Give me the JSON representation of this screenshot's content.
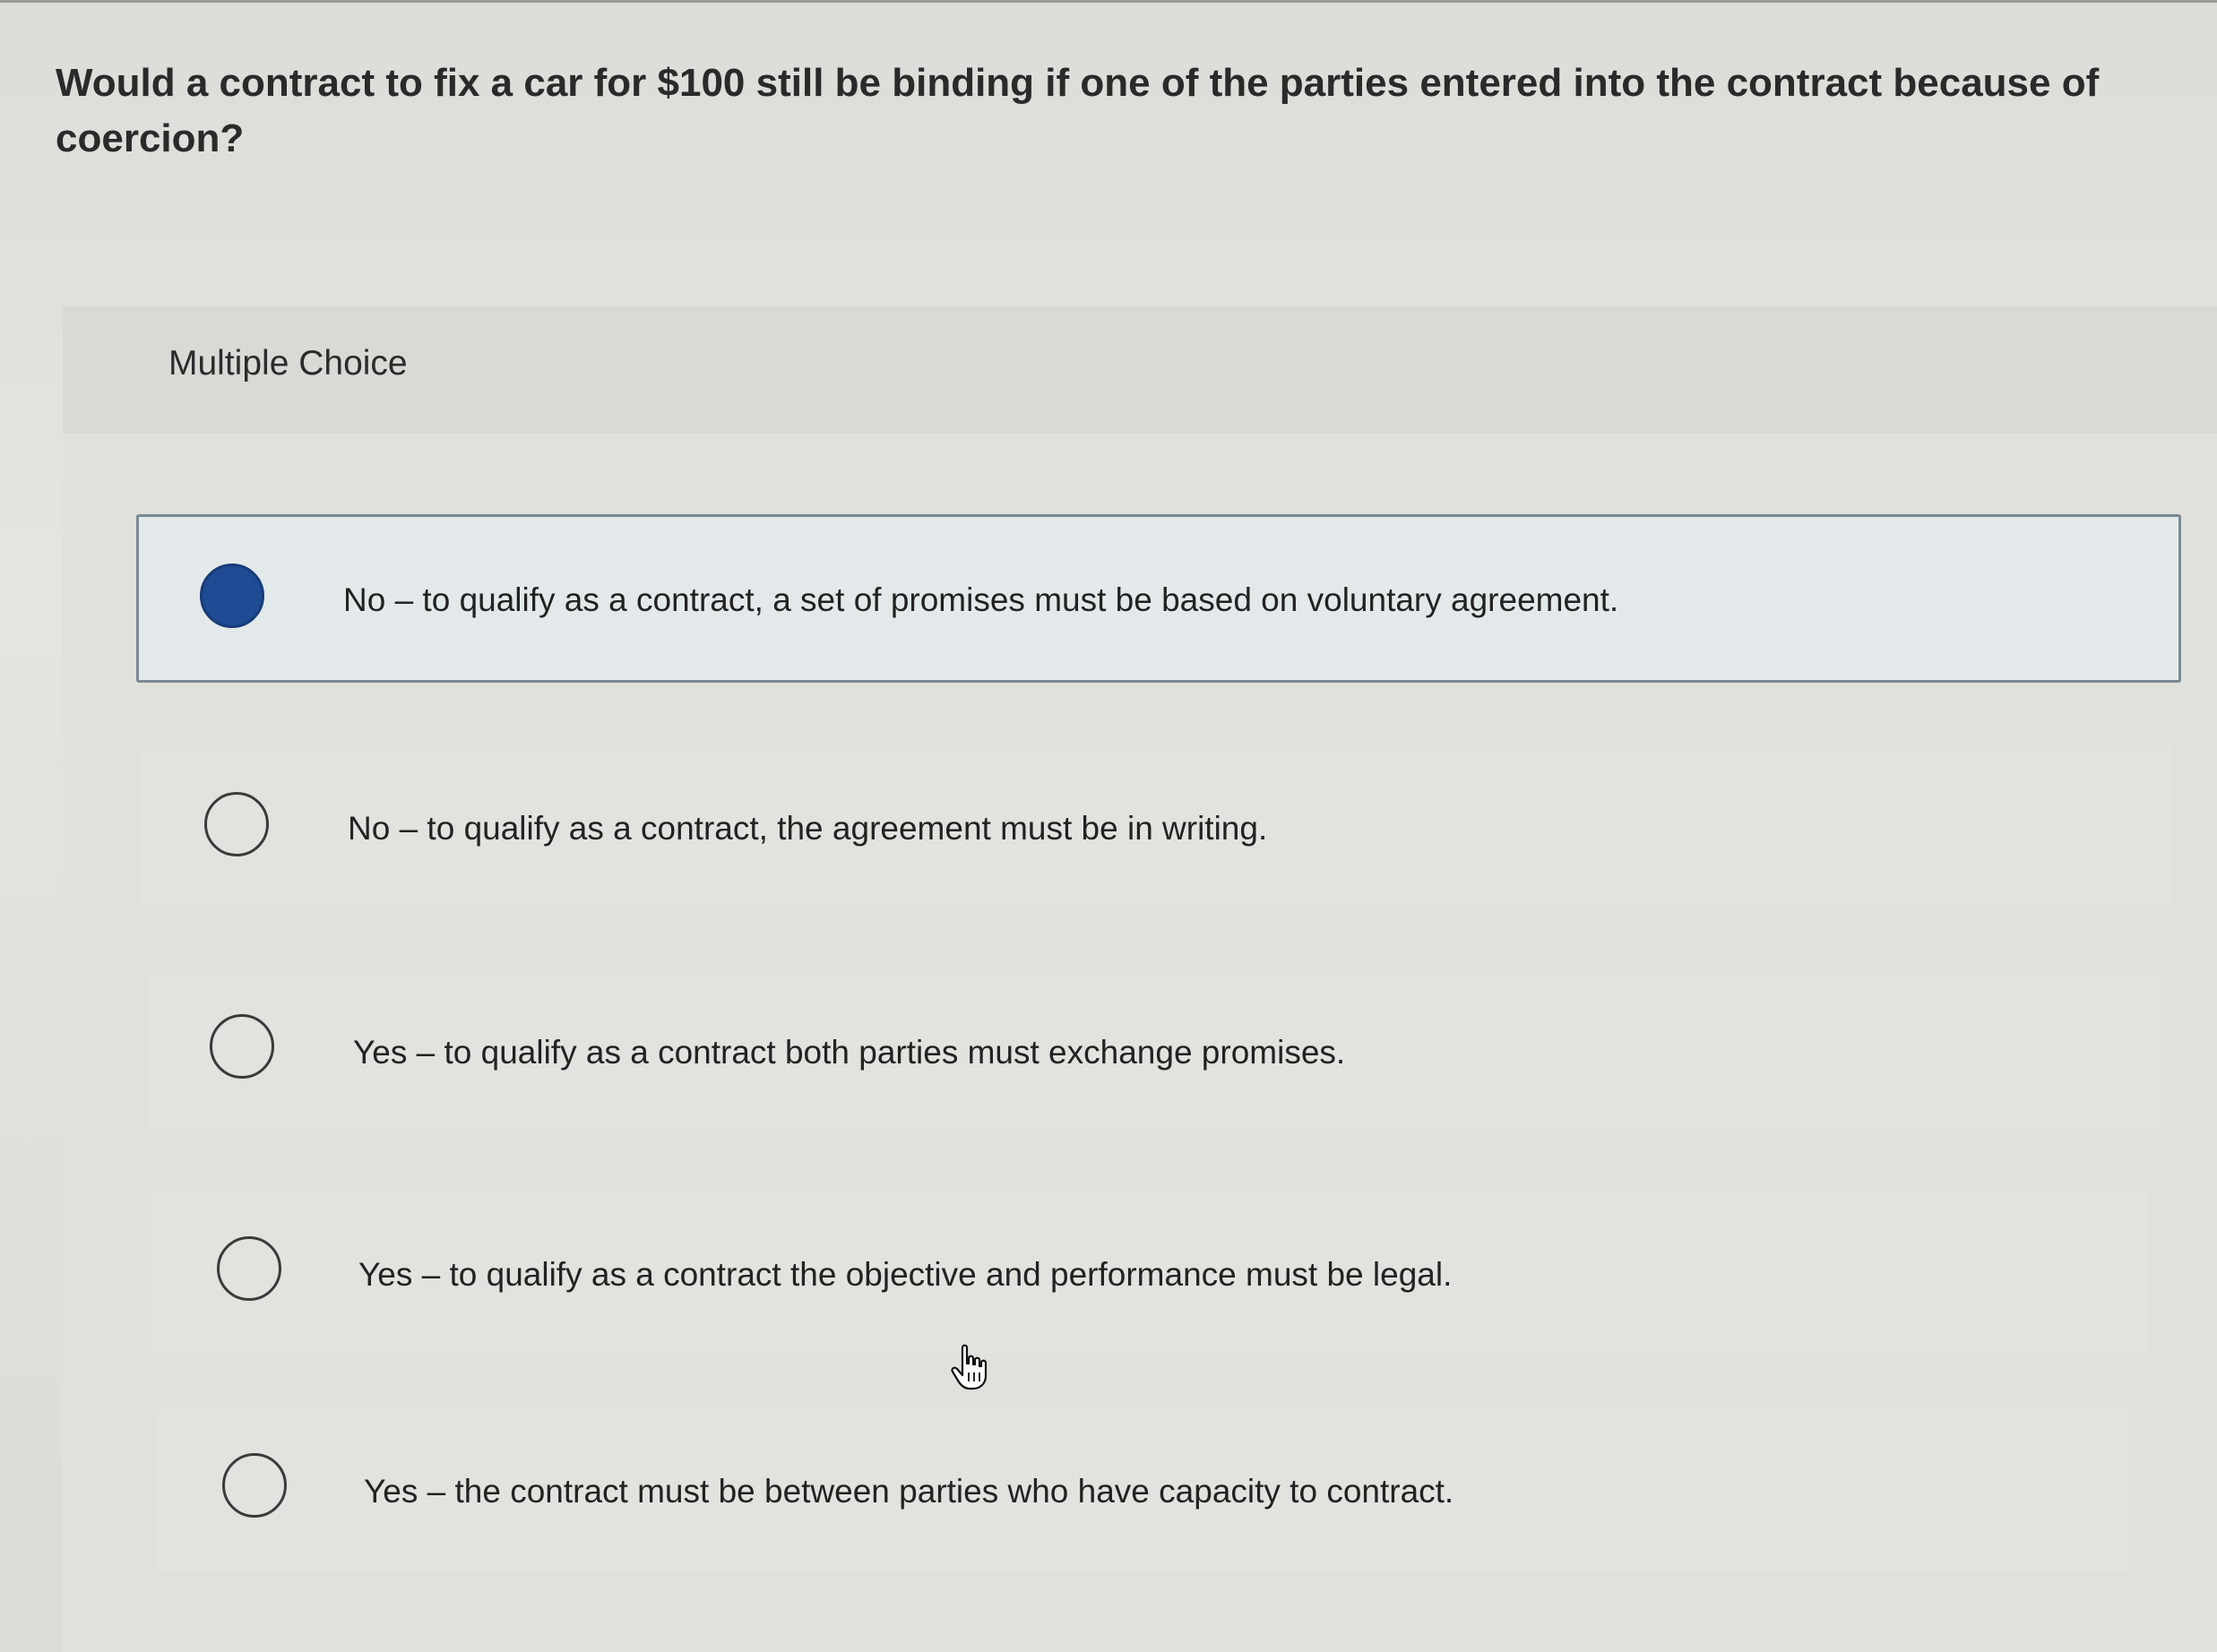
{
  "question": {
    "text": "Would a contract to fix a car for $100 still be binding if one of the parties entered into the contract because of coercion?"
  },
  "section": {
    "label": "Multiple Choice"
  },
  "choices": [
    {
      "text": "No – to qualify as a contract, a set of promises must be based on voluntary agreement.",
      "selected": true
    },
    {
      "text": "No – to qualify as a contract, the agreement must be in writing.",
      "selected": false
    },
    {
      "text": "Yes – to qualify as a contract both parties must exchange promises.",
      "selected": false
    },
    {
      "text": "Yes – to qualify as a contract the objective and performance must be legal.",
      "selected": false
    },
    {
      "text": "Yes – the contract must be between parties who have capacity to contract.",
      "selected": false
    }
  ],
  "colors": {
    "selected_radio": "#1e4b93",
    "selected_border": "#7b8a94"
  },
  "icons": {
    "cursor": "hand-pointer-icon",
    "radio": "radio-button-icon"
  }
}
